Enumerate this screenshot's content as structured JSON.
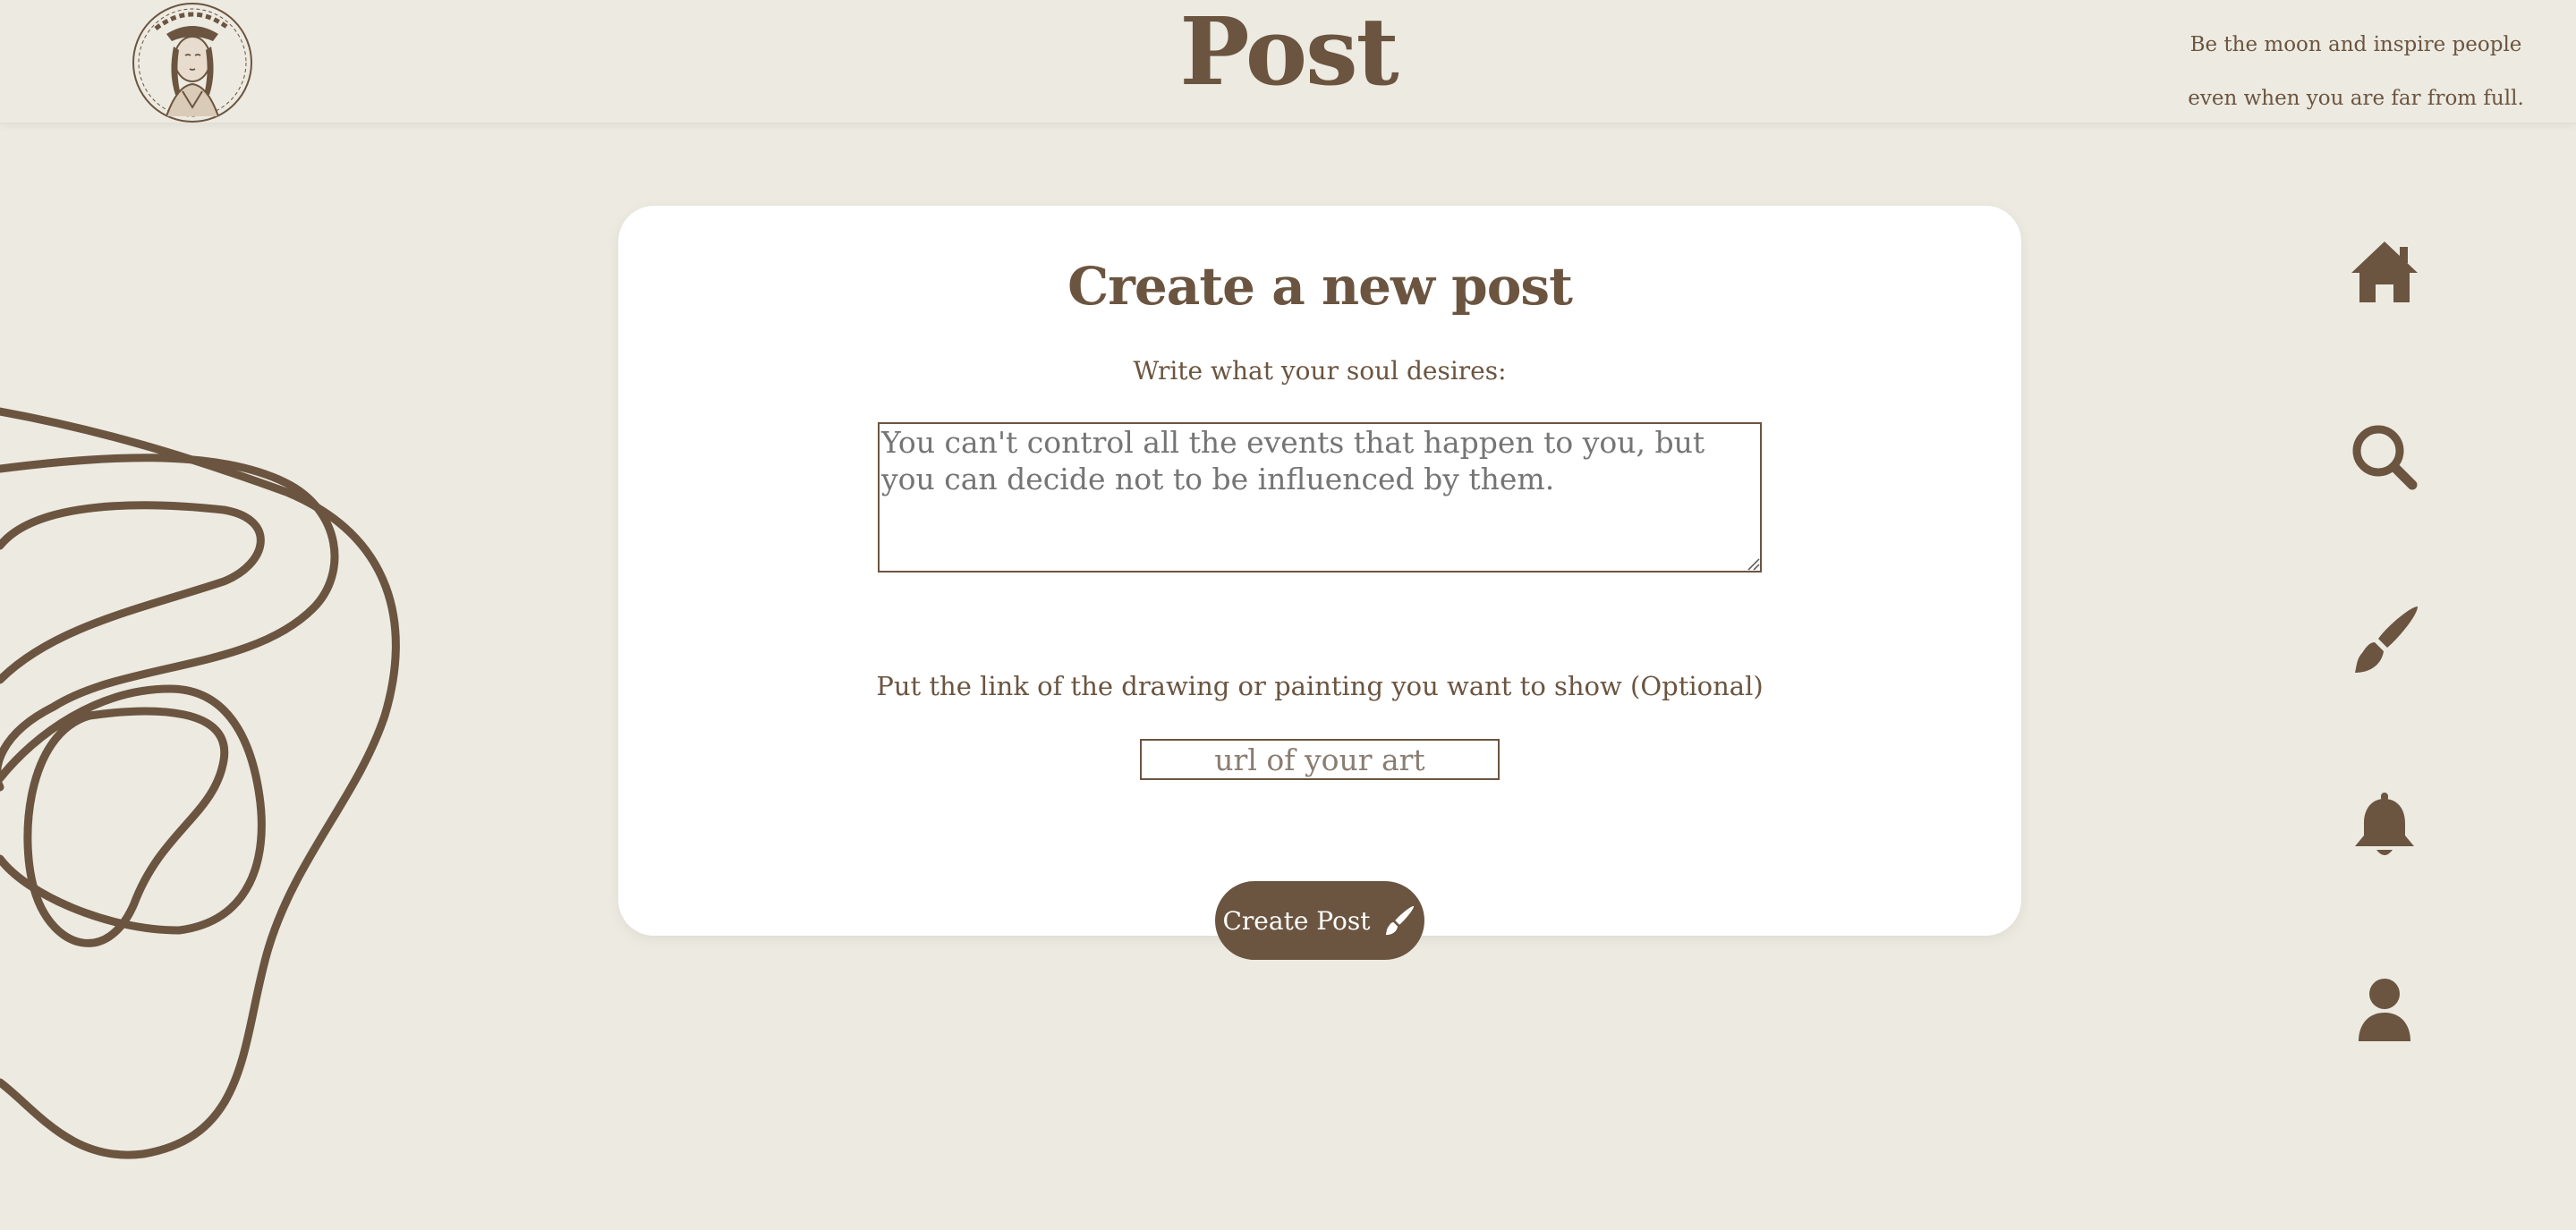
{
  "header": {
    "brand": "Post",
    "quote_line1": "Be the moon and inspire people",
    "quote_line2": "even when you are far from full."
  },
  "form": {
    "title": "Create a new post",
    "text_label": "Write what your soul desires:",
    "text_placeholder": "You can't control all the events that happen to you, but you can decide not to be influenced by them.",
    "text_value": "",
    "link_label": "Put the link of the drawing or painting you want to show (Optional)",
    "link_placeholder": "url of your art",
    "link_value": "",
    "submit_label": "Create Post",
    "submit_icon": "paintbrush-icon"
  },
  "nav": {
    "items": [
      {
        "icon": "home-icon"
      },
      {
        "icon": "search-icon"
      },
      {
        "icon": "paintbrush-icon"
      },
      {
        "icon": "bell-icon"
      },
      {
        "icon": "user-icon"
      }
    ]
  },
  "colors": {
    "background": "#edeae1",
    "accent": "#6b5540",
    "card": "#ffffff",
    "placeholder": "#8a7d72"
  }
}
